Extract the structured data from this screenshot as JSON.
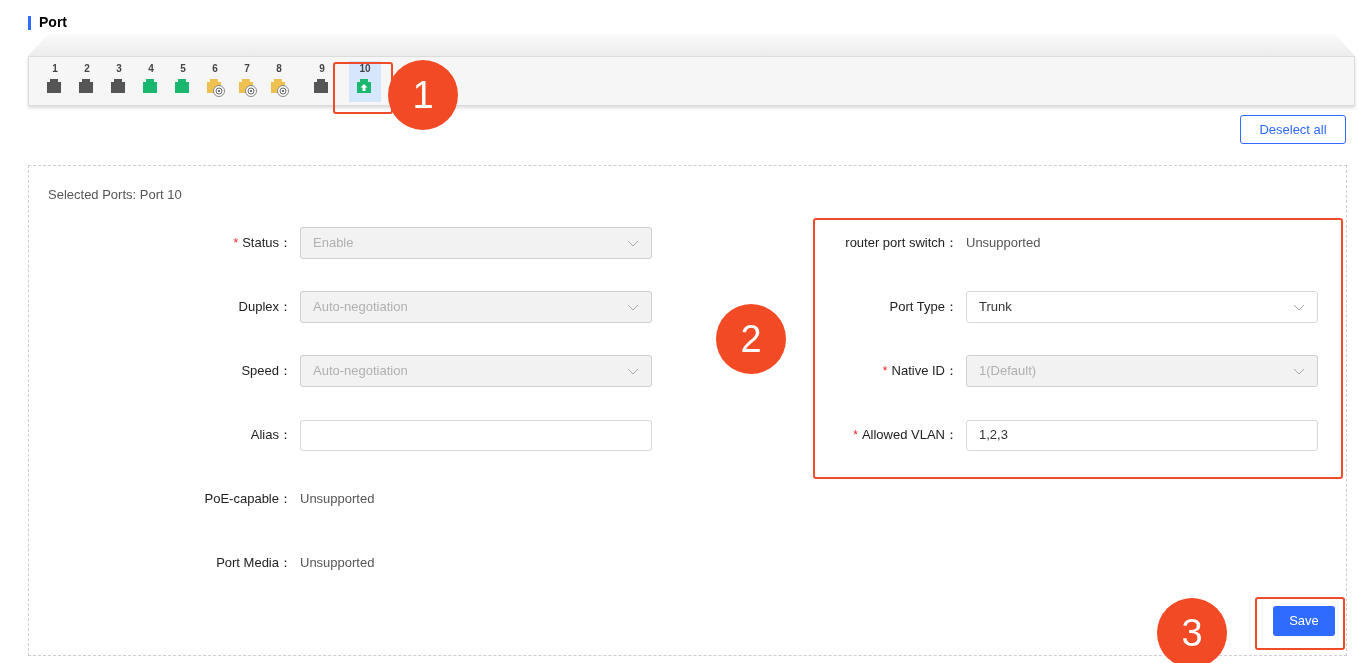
{
  "section_title": "Port",
  "port_groups": [
    [
      {
        "label": "1",
        "kind": "plain",
        "color": "#555555",
        "selected": false
      },
      {
        "label": "2",
        "kind": "plain",
        "color": "#555555",
        "selected": false
      },
      {
        "label": "3",
        "kind": "plain",
        "color": "#555555",
        "selected": false
      },
      {
        "label": "4",
        "kind": "plain",
        "color": "#19b86e",
        "selected": false
      },
      {
        "label": "5",
        "kind": "plain",
        "color": "#19b86e",
        "selected": false
      },
      {
        "label": "6",
        "kind": "fiber",
        "color": "#f0c050",
        "selected": false
      },
      {
        "label": "7",
        "kind": "fiber",
        "color": "#f0c050",
        "selected": false
      },
      {
        "label": "8",
        "kind": "fiber",
        "color": "#f0c050",
        "selected": false
      }
    ],
    [
      {
        "label": "9",
        "kind": "plain",
        "color": "#555555",
        "selected": false
      }
    ],
    [
      {
        "label": "10",
        "kind": "uplink",
        "color": "#19b86e",
        "selected": true
      }
    ]
  ],
  "deselect_button": "Deselect all",
  "selected_ports": "Selected Ports: Port 10",
  "left_fields": [
    {
      "label": "Status：",
      "required_mark": "*",
      "kind": "select",
      "value": "Enable",
      "disabled": true
    },
    {
      "label": "Duplex：",
      "kind": "select",
      "value": "Auto-negotiation",
      "disabled": true
    },
    {
      "label": "Speed：",
      "kind": "select",
      "value": "Auto-negotiation",
      "disabled": true
    },
    {
      "label": "Alias：",
      "kind": "input"
    },
    {
      "label": "PoE-capable：",
      "kind": "text",
      "value": "Unsupported"
    },
    {
      "label": "Port Media：",
      "kind": "text",
      "value": "Unsupported"
    }
  ],
  "right_fields": [
    {
      "label": "router port switch：",
      "kind": "text",
      "value": "Unsupported"
    },
    {
      "label": "Port Type：",
      "kind": "select",
      "value": "Trunk",
      "disabled": false
    },
    {
      "label": "Native ID：",
      "required_mark": "*",
      "kind": "select",
      "value": "1(Default)",
      "disabled": true
    },
    {
      "label": "Allowed VLAN：",
      "required_mark": "*",
      "kind": "input",
      "value": "1,2,3",
      "disabled": false
    }
  ],
  "save_button": "Save",
  "callouts": [
    "1",
    "2",
    "3"
  ]
}
